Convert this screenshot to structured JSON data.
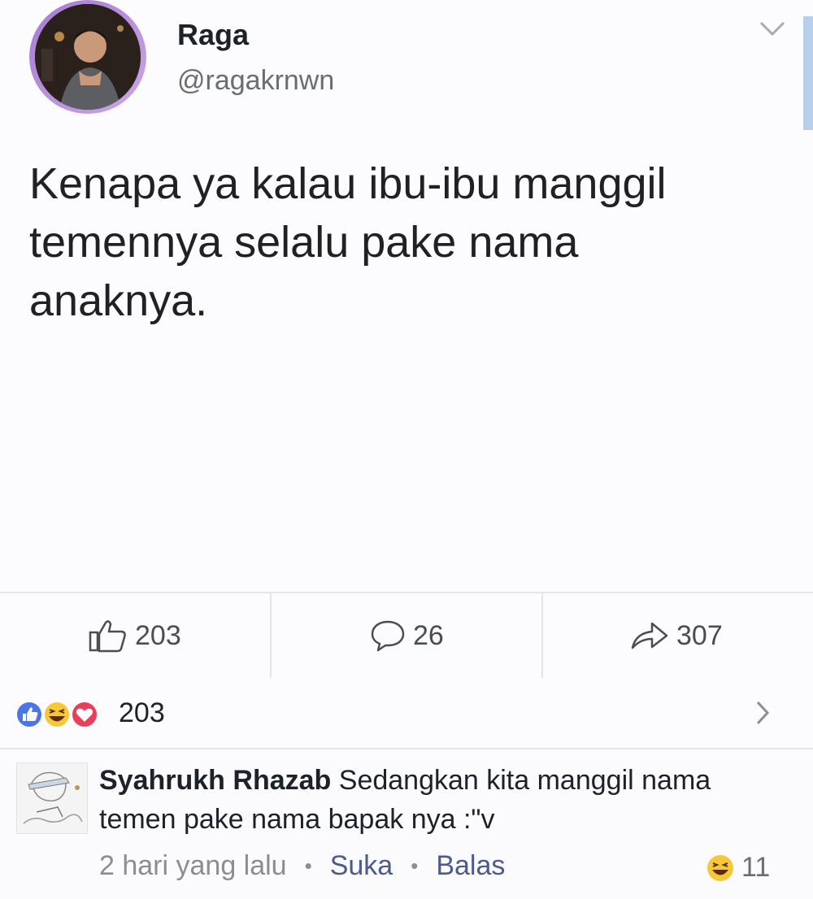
{
  "author": {
    "name": "Raga",
    "handle": "@ragakrnwn"
  },
  "tweet": {
    "text": "Kenapa ya kalau ibu-ibu manggil\ntemennya selalu pake nama\nanaknya."
  },
  "actions": {
    "likes": "203",
    "comments": "26",
    "shares": "307"
  },
  "reactions": {
    "count": "203",
    "icons": [
      "like-icon",
      "haha-icon",
      "love-icon"
    ]
  },
  "comment": {
    "author": "Syahrukh Rhazab",
    "text": "Sedangkan kita manggil nama temen pake nama bapak nya :\"v",
    "time": "2 hari yang lalu",
    "like_label": "Suka",
    "reply_label": "Balas",
    "reaction_count": "11"
  },
  "colors": {
    "like_blue": "#4a76e8",
    "love_red": "#e8405a",
    "haha_yellow": "#f7c73a",
    "avatar_ring": "#b58fd8"
  }
}
